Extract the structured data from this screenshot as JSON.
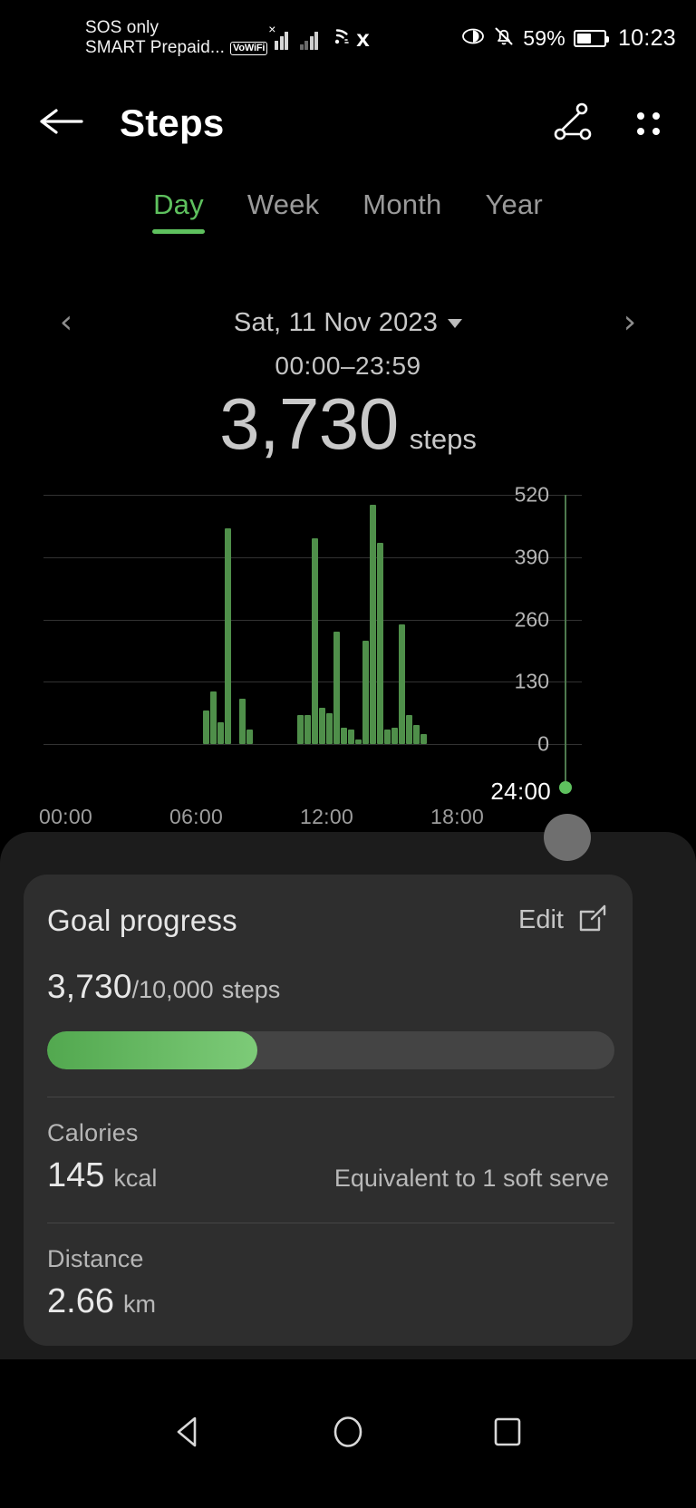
{
  "status_bar": {
    "carrier_line1": "SOS only",
    "carrier_line2": "SMART Prepaid...",
    "vowifi_badge": "VoWiFi",
    "battery_percent": "59%",
    "clock": "10:23",
    "icons": [
      "signal-no-service-icon",
      "signal-bars-icon",
      "wifi-icon",
      "x-app-icon",
      "eye-comfort-icon",
      "mute-bell-icon",
      "battery-icon"
    ]
  },
  "app_bar": {
    "back_label": "back-arrow",
    "title": "Steps",
    "share_label": "share-icon",
    "more_label": "more-options"
  },
  "tabs": [
    {
      "label": "Day",
      "active": true
    },
    {
      "label": "Week",
      "active": false
    },
    {
      "label": "Month",
      "active": false
    },
    {
      "label": "Year",
      "active": false
    }
  ],
  "date_nav": {
    "prev": "‹",
    "date": "Sat, 11 Nov 2023",
    "next": "›",
    "time_range": "00:00–23:59"
  },
  "summary": {
    "value": "3,730",
    "unit": "steps"
  },
  "chart_data": {
    "type": "bar",
    "title": "",
    "xlabel": "",
    "ylabel": "",
    "ylim": [
      0,
      520
    ],
    "yticks": [
      "0",
      "130",
      "260",
      "390",
      "520"
    ],
    "xticks": [
      "00:00",
      "06:00",
      "12:00",
      "18:00"
    ],
    "grid": true,
    "bar_color": "#4f8f4a",
    "marker_label": "24:00",
    "marker_color": "#5ec15e",
    "x_minutes_range": [
      0,
      1440
    ],
    "categories": [
      "07:20",
      "07:40",
      "08:00",
      "08:20",
      "08:40",
      "09:00",
      "09:20",
      "09:40",
      "10:00",
      "11:40",
      "12:00",
      "12:20",
      "12:40",
      "13:00",
      "13:20",
      "13:40",
      "14:00",
      "14:20",
      "14:40",
      "15:00",
      "15:20",
      "15:40",
      "16:00",
      "16:20",
      "16:40",
      "17:00",
      "17:20",
      "17:40"
    ],
    "values": [
      70,
      110,
      45,
      450,
      0,
      95,
      30,
      0,
      0,
      60,
      60,
      430,
      75,
      65,
      235,
      35,
      30,
      10,
      215,
      500,
      420,
      30,
      35,
      250,
      60,
      40,
      20,
      0
    ]
  },
  "goal_card": {
    "title": "Goal progress",
    "edit_label": "Edit",
    "current": "3,730",
    "target": "/10,000",
    "unit": "steps",
    "progress_percent": 37,
    "metrics": [
      {
        "label": "Calories",
        "value": "145",
        "unit": "kcal",
        "note": "Equivalent to 1 soft serve"
      },
      {
        "label": "Distance",
        "value": "2.66",
        "unit": "km",
        "note": ""
      }
    ]
  },
  "nav_bar": {
    "back": "back-triangle",
    "home": "home-circle",
    "recents": "recents-square"
  }
}
